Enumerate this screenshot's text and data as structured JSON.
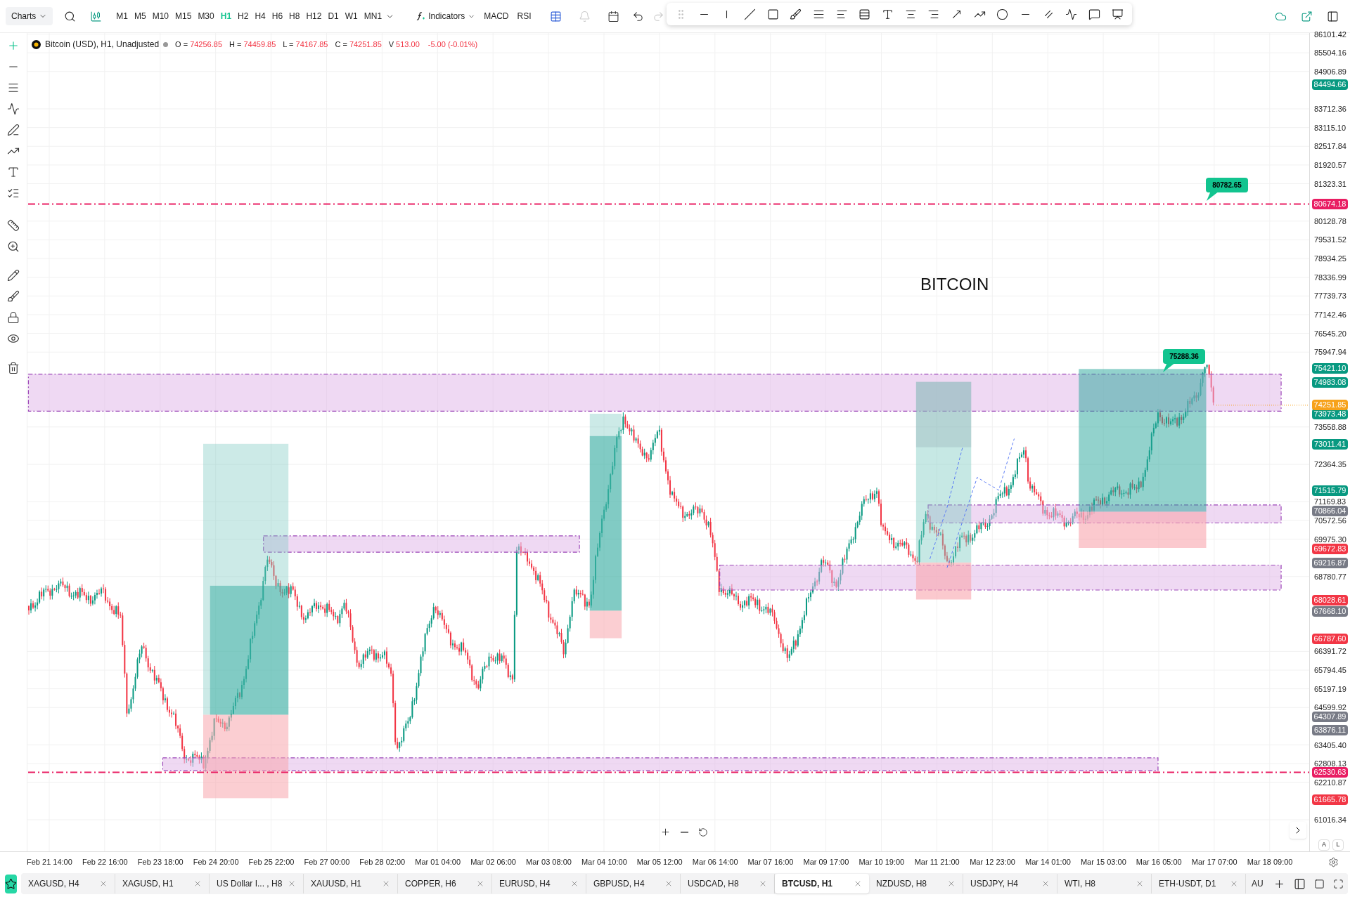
{
  "toolbar": {
    "chart_menu": "Charts",
    "timeframes": [
      {
        "label": "M1",
        "selected": false
      },
      {
        "label": "M5",
        "selected": false
      },
      {
        "label": "M10",
        "selected": false
      },
      {
        "label": "M15",
        "selected": false
      },
      {
        "label": "M30",
        "selected": false
      },
      {
        "label": "H1",
        "selected": true
      },
      {
        "label": "H2",
        "selected": false
      },
      {
        "label": "H4",
        "selected": false
      },
      {
        "label": "H6",
        "selected": false
      },
      {
        "label": "H8",
        "selected": false
      },
      {
        "label": "H12",
        "selected": false
      },
      {
        "label": "D1",
        "selected": false
      },
      {
        "label": "W1",
        "selected": false
      },
      {
        "label": "MN1",
        "selected": false
      }
    ],
    "indicators": "Indicators",
    "shortcuts": [
      "MACD",
      "RSI"
    ],
    "history": [
      {
        "kind": "undo",
        "disabled": false
      },
      {
        "kind": "redo",
        "disabled": true
      }
    ]
  },
  "legend": {
    "symbol": "Bitcoin (USD), H1, Unadjusted",
    "fields": [
      {
        "label": "O =",
        "value": "74256.85"
      },
      {
        "label": "H =",
        "value": "74459.85"
      },
      {
        "label": "L =",
        "value": "74167.85"
      },
      {
        "label": "C =",
        "value": "74251.85"
      },
      {
        "label": "V",
        "value": "513.00"
      }
    ],
    "change": "-5.00 (-0.01%)"
  },
  "chart": {
    "annotation": "BITCOIN",
    "callouts": [
      {
        "text": "80782.65"
      },
      {
        "text": "75288.36"
      }
    ]
  },
  "price_axis": {
    "ticks": [
      "86101.42",
      "85504.16",
      "84906.89",
      "83712.36",
      "83115.10",
      "82517.84",
      "81920.57",
      "81323.31",
      "80128.78",
      "79531.52",
      "78934.25",
      "78336.99",
      "77739.73",
      "77142.46",
      "76545.20",
      "75947.94",
      "73558.88",
      "72364.35",
      "71169.83",
      "70572.56",
      "69975.30",
      "68780.77",
      "66391.72",
      "65794.45",
      "65197.19",
      "64599.92",
      "63405.40",
      "62808.13",
      "62210.87",
      "61016.34"
    ],
    "badges": [
      {
        "text": "84494.66",
        "color": "#089981"
      },
      {
        "text": "80674.18",
        "color": "#e91e63"
      },
      {
        "text": "75421.10",
        "color": "#089981"
      },
      {
        "text": "74983.08",
        "color": "#089981"
      },
      {
        "text": "74251.85",
        "color": "#f7a21b"
      },
      {
        "text": "73973.48",
        "color": "#089981"
      },
      {
        "text": "73011.41",
        "color": "#089981"
      },
      {
        "text": "71515.79",
        "color": "#089981"
      },
      {
        "text": "70866.04",
        "color": "#787b86"
      },
      {
        "text": "69672.83",
        "color": "#f23645"
      },
      {
        "text": "69216.87",
        "color": "#787b86"
      },
      {
        "text": "68028.61",
        "color": "#f23645"
      },
      {
        "text": "67668.10",
        "color": "#787b86"
      },
      {
        "text": "66787.60",
        "color": "#f23645"
      },
      {
        "text": "64307.89",
        "color": "#787b86"
      },
      {
        "text": "63876.11",
        "color": "#787b86"
      },
      {
        "text": "62530.63",
        "color": "#e91e63"
      },
      {
        "text": "61665.78",
        "color": "#f23645"
      }
    ],
    "scale_buttons": [
      "A",
      "L"
    ]
  },
  "time_axis": {
    "ticks": [
      "Feb 21 14:00",
      "Feb 22 16:00",
      "Feb 23 18:00",
      "Feb 24 20:00",
      "Feb 25 22:00",
      "Feb 27 00:00",
      "Feb 28 02:00",
      "Mar 01 04:00",
      "Mar 02 06:00",
      "Mar 03 08:00",
      "Mar 04 10:00",
      "Mar 05 12:00",
      "Mar 06 14:00",
      "Mar 07 16:00",
      "Mar 09 17:00",
      "Mar 10 19:00",
      "Mar 11 21:00",
      "Mar 12 23:00",
      "Mar 14 01:00",
      "Mar 15 03:00",
      "Mar 16 05:00",
      "Mar 17 07:00",
      "Mar 18 09:00"
    ]
  },
  "tabs": [
    {
      "label": "XAGUSD, H4",
      "selected": false
    },
    {
      "label": "XAGUSD, H1",
      "selected": false
    },
    {
      "label": "US Dollar I... , H8",
      "selected": false
    },
    {
      "label": "XAUUSD, H1",
      "selected": false
    },
    {
      "label": "COPPER, H6",
      "selected": false
    },
    {
      "label": "EURUSD, H4",
      "selected": false
    },
    {
      "label": "GBPUSD, H4",
      "selected": false
    },
    {
      "label": "USDCAD, H8",
      "selected": false
    },
    {
      "label": "BTCUSD, H1",
      "selected": true
    },
    {
      "label": "NZDUSD, H8",
      "selected": false
    },
    {
      "label": "USDJPY, H4",
      "selected": false
    },
    {
      "label": "WTI, H8",
      "selected": false
    },
    {
      "label": "ETH-USDT, D1",
      "selected": false
    }
  ],
  "overflow_tab": "AU"
}
